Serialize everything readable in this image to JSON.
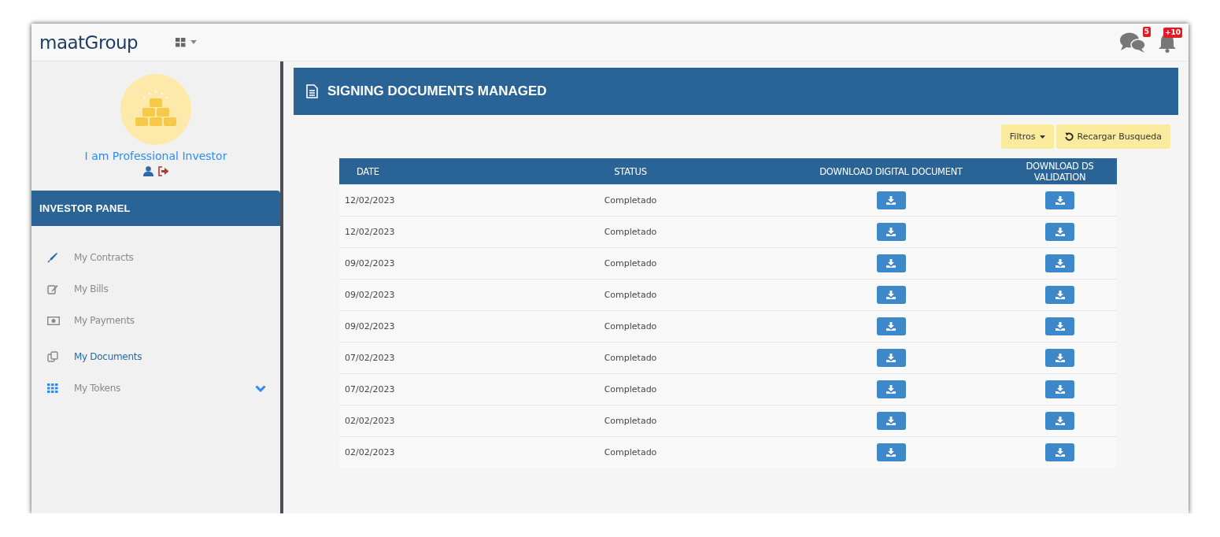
{
  "header": {
    "logo": "maatGroup",
    "chat_badge": "5",
    "bell_badge": "+10"
  },
  "sidebar": {
    "user_name": "I am Professional Investor",
    "panel_title": "INVESTOR PANEL",
    "items": [
      {
        "label": "My Contracts",
        "kind": "pen",
        "selected": false,
        "submenu": false
      },
      {
        "label": "My Bills",
        "kind": "edit",
        "selected": false,
        "submenu": false
      },
      {
        "label": "My Payments",
        "kind": "money",
        "selected": false,
        "submenu": false
      },
      {
        "label": "My Documents",
        "kind": "copy",
        "selected": true,
        "submenu": false
      },
      {
        "label": "My Tokens",
        "kind": "grid",
        "selected": false,
        "submenu": true
      }
    ]
  },
  "page": {
    "title": "SIGNING DOCUMENTS MANAGED",
    "buttons": [
      {
        "label": "Filtros",
        "kind": "dropdown"
      },
      {
        "label": "Recargar Busqueda",
        "kind": "reload"
      }
    ]
  },
  "table": {
    "columns": [
      "DATE",
      "STATUS",
      "DOWNLOAD DIGITAL DOCUMENT",
      "DOWNLOAD DS VALIDATION"
    ],
    "rows": [
      {
        "date": "12/02/2023",
        "status": "Completado"
      },
      {
        "date": "12/02/2023",
        "status": "Completado"
      },
      {
        "date": "09/02/2023",
        "status": "Completado"
      },
      {
        "date": "09/02/2023",
        "status": "Completado"
      },
      {
        "date": "09/02/2023",
        "status": "Completado"
      },
      {
        "date": "07/02/2023",
        "status": "Completado"
      },
      {
        "date": "07/02/2023",
        "status": "Completado"
      },
      {
        "date": "02/02/2023",
        "status": "Completado"
      },
      {
        "date": "02/02/2023",
        "status": "Completado"
      }
    ]
  }
}
